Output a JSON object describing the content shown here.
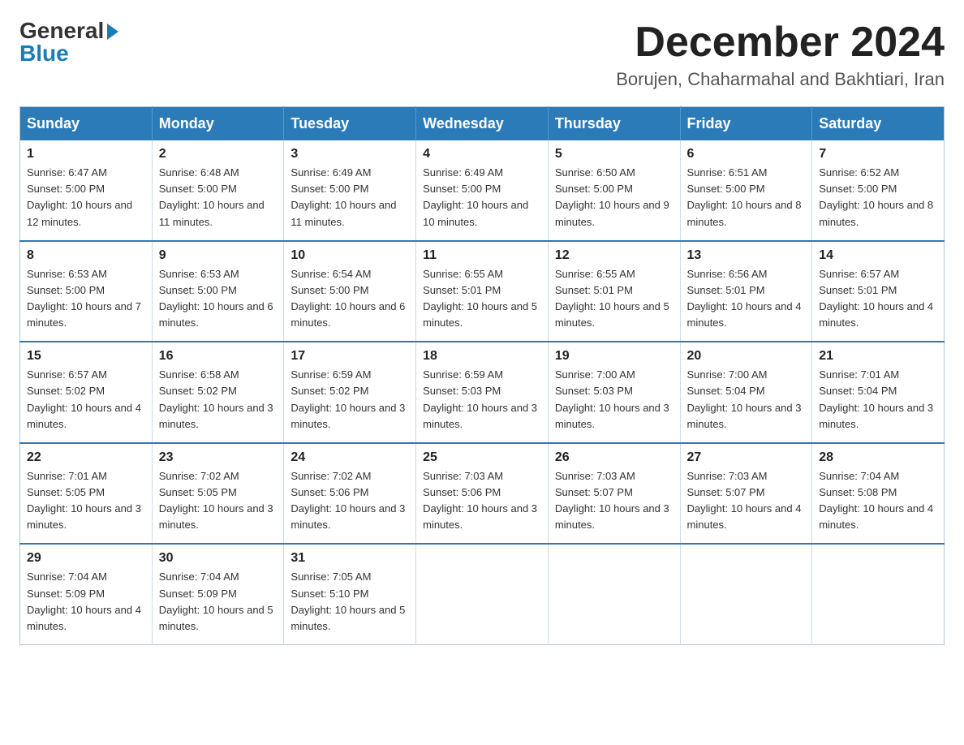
{
  "logo": {
    "general": "General",
    "blue": "Blue"
  },
  "title": "December 2024",
  "subtitle": "Borujen, Chaharmahal and Bakhtiari, Iran",
  "weekdays": [
    "Sunday",
    "Monday",
    "Tuesday",
    "Wednesday",
    "Thursday",
    "Friday",
    "Saturday"
  ],
  "weeks": [
    [
      {
        "day": "1",
        "sunrise": "6:47 AM",
        "sunset": "5:00 PM",
        "daylight": "10 hours and 12 minutes."
      },
      {
        "day": "2",
        "sunrise": "6:48 AM",
        "sunset": "5:00 PM",
        "daylight": "10 hours and 11 minutes."
      },
      {
        "day": "3",
        "sunrise": "6:49 AM",
        "sunset": "5:00 PM",
        "daylight": "10 hours and 11 minutes."
      },
      {
        "day": "4",
        "sunrise": "6:49 AM",
        "sunset": "5:00 PM",
        "daylight": "10 hours and 10 minutes."
      },
      {
        "day": "5",
        "sunrise": "6:50 AM",
        "sunset": "5:00 PM",
        "daylight": "10 hours and 9 minutes."
      },
      {
        "day": "6",
        "sunrise": "6:51 AM",
        "sunset": "5:00 PM",
        "daylight": "10 hours and 8 minutes."
      },
      {
        "day": "7",
        "sunrise": "6:52 AM",
        "sunset": "5:00 PM",
        "daylight": "10 hours and 8 minutes."
      }
    ],
    [
      {
        "day": "8",
        "sunrise": "6:53 AM",
        "sunset": "5:00 PM",
        "daylight": "10 hours and 7 minutes."
      },
      {
        "day": "9",
        "sunrise": "6:53 AM",
        "sunset": "5:00 PM",
        "daylight": "10 hours and 6 minutes."
      },
      {
        "day": "10",
        "sunrise": "6:54 AM",
        "sunset": "5:00 PM",
        "daylight": "10 hours and 6 minutes."
      },
      {
        "day": "11",
        "sunrise": "6:55 AM",
        "sunset": "5:01 PM",
        "daylight": "10 hours and 5 minutes."
      },
      {
        "day": "12",
        "sunrise": "6:55 AM",
        "sunset": "5:01 PM",
        "daylight": "10 hours and 5 minutes."
      },
      {
        "day": "13",
        "sunrise": "6:56 AM",
        "sunset": "5:01 PM",
        "daylight": "10 hours and 4 minutes."
      },
      {
        "day": "14",
        "sunrise": "6:57 AM",
        "sunset": "5:01 PM",
        "daylight": "10 hours and 4 minutes."
      }
    ],
    [
      {
        "day": "15",
        "sunrise": "6:57 AM",
        "sunset": "5:02 PM",
        "daylight": "10 hours and 4 minutes."
      },
      {
        "day": "16",
        "sunrise": "6:58 AM",
        "sunset": "5:02 PM",
        "daylight": "10 hours and 3 minutes."
      },
      {
        "day": "17",
        "sunrise": "6:59 AM",
        "sunset": "5:02 PM",
        "daylight": "10 hours and 3 minutes."
      },
      {
        "day": "18",
        "sunrise": "6:59 AM",
        "sunset": "5:03 PM",
        "daylight": "10 hours and 3 minutes."
      },
      {
        "day": "19",
        "sunrise": "7:00 AM",
        "sunset": "5:03 PM",
        "daylight": "10 hours and 3 minutes."
      },
      {
        "day": "20",
        "sunrise": "7:00 AM",
        "sunset": "5:04 PM",
        "daylight": "10 hours and 3 minutes."
      },
      {
        "day": "21",
        "sunrise": "7:01 AM",
        "sunset": "5:04 PM",
        "daylight": "10 hours and 3 minutes."
      }
    ],
    [
      {
        "day": "22",
        "sunrise": "7:01 AM",
        "sunset": "5:05 PM",
        "daylight": "10 hours and 3 minutes."
      },
      {
        "day": "23",
        "sunrise": "7:02 AM",
        "sunset": "5:05 PM",
        "daylight": "10 hours and 3 minutes."
      },
      {
        "day": "24",
        "sunrise": "7:02 AM",
        "sunset": "5:06 PM",
        "daylight": "10 hours and 3 minutes."
      },
      {
        "day": "25",
        "sunrise": "7:03 AM",
        "sunset": "5:06 PM",
        "daylight": "10 hours and 3 minutes."
      },
      {
        "day": "26",
        "sunrise": "7:03 AM",
        "sunset": "5:07 PM",
        "daylight": "10 hours and 3 minutes."
      },
      {
        "day": "27",
        "sunrise": "7:03 AM",
        "sunset": "5:07 PM",
        "daylight": "10 hours and 4 minutes."
      },
      {
        "day": "28",
        "sunrise": "7:04 AM",
        "sunset": "5:08 PM",
        "daylight": "10 hours and 4 minutes."
      }
    ],
    [
      {
        "day": "29",
        "sunrise": "7:04 AM",
        "sunset": "5:09 PM",
        "daylight": "10 hours and 4 minutes."
      },
      {
        "day": "30",
        "sunrise": "7:04 AM",
        "sunset": "5:09 PM",
        "daylight": "10 hours and 5 minutes."
      },
      {
        "day": "31",
        "sunrise": "7:05 AM",
        "sunset": "5:10 PM",
        "daylight": "10 hours and 5 minutes."
      },
      null,
      null,
      null,
      null
    ]
  ]
}
